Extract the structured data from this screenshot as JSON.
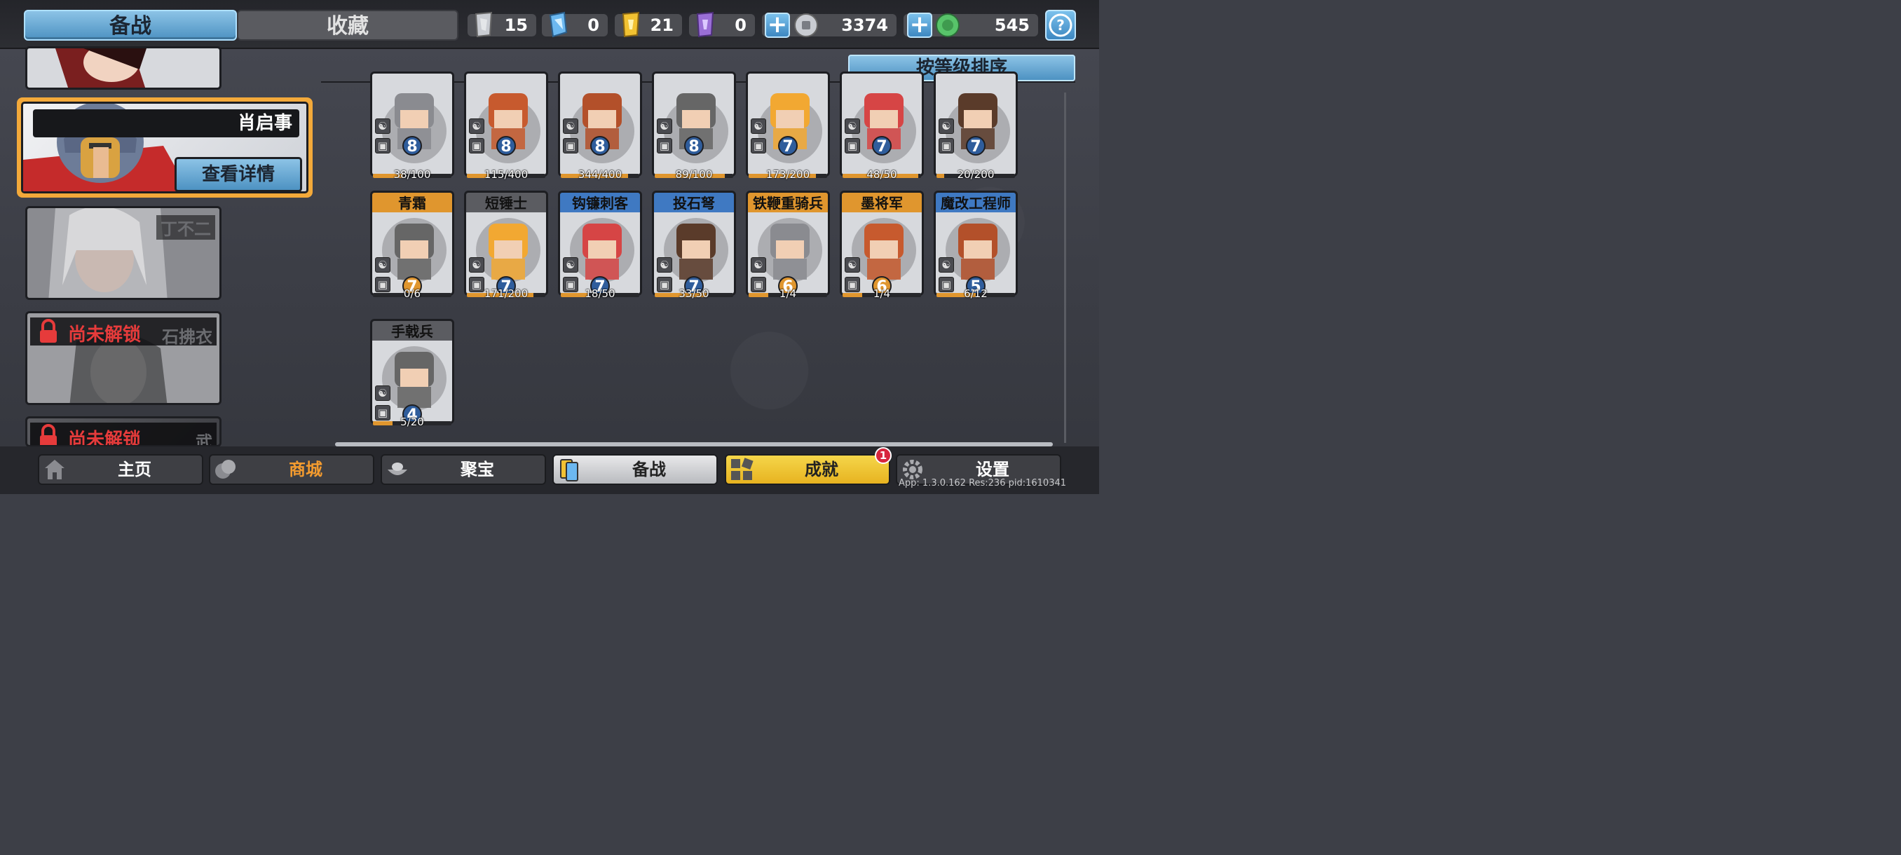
{
  "tabs": {
    "active": "备战",
    "inactive": "收藏"
  },
  "resources": [
    {
      "icon": "silver-scroll-icon",
      "value": "15",
      "color": "#c9ccd2"
    },
    {
      "icon": "blue-crystal-icon",
      "value": "0",
      "color": "#6cb8f0"
    },
    {
      "icon": "gold-scroll-icon",
      "value": "21",
      "color": "#f2c232"
    },
    {
      "icon": "purple-scroll-icon",
      "value": "0",
      "color": "#9a6fd6"
    },
    {
      "icon": "silver-coin-icon",
      "value": "3374",
      "color": "#c9ccd2"
    },
    {
      "icon": "jade-coin-icon",
      "value": "545",
      "color": "#58c46a"
    }
  ],
  "sort_label": "按等级排序",
  "heroes": [
    {
      "name": "肖启事",
      "detail_label": "查看详情"
    },
    {
      "name": "丁不二"
    },
    {
      "lock_label": "尚未解锁",
      "name": "石拂衣"
    },
    {
      "lock_label": "尚未解锁",
      "name": "武"
    }
  ],
  "units_row1": [
    {
      "level": "8",
      "count": "38/100",
      "progress": 0.38
    },
    {
      "level": "8",
      "count": "115/400",
      "progress": 0.29
    },
    {
      "level": "8",
      "count": "344/400",
      "progress": 0.86
    },
    {
      "level": "8",
      "count": "89/100",
      "progress": 0.89
    },
    {
      "level": "7",
      "count": "173/200",
      "progress": 0.86
    },
    {
      "level": "7",
      "count": "48/50",
      "progress": 0.96
    },
    {
      "level": "7",
      "count": "20/200",
      "progress": 0.1
    }
  ],
  "units_row2": [
    {
      "name": "青霜",
      "level": "7",
      "count": "0/6",
      "progress": 0.0,
      "tier": "gold"
    },
    {
      "name": "短锤士",
      "level": "7",
      "count": "171/200",
      "progress": 0.85,
      "tier": "gray"
    },
    {
      "name": "钩镰刺客",
      "level": "7",
      "count": "18/50",
      "progress": 0.36,
      "tier": "blue"
    },
    {
      "name": "投石弩",
      "level": "7",
      "count": "33/50",
      "progress": 0.66,
      "tier": "blue"
    },
    {
      "name": "铁鞭重骑兵",
      "level": "6",
      "count": "1/4",
      "progress": 0.25,
      "tier": "gold"
    },
    {
      "name": "墨将军",
      "level": "6",
      "count": "1/4",
      "progress": 0.25,
      "tier": "gold"
    },
    {
      "name": "魔改工程师",
      "level": "5",
      "count": "6/12",
      "progress": 0.5,
      "tier": "blue"
    }
  ],
  "units_row3": [
    {
      "name": "手戟兵",
      "level": "4",
      "count": "5/20",
      "progress": 0.25,
      "tier": "gray"
    }
  ],
  "nav": [
    {
      "label": "主页",
      "icon": "house-icon"
    },
    {
      "label": "商城",
      "icon": "coins-icon"
    },
    {
      "label": "聚宝",
      "icon": "treasure-bowl-icon"
    },
    {
      "label": "备战",
      "icon": "cards-icon"
    },
    {
      "label": "成就",
      "icon": "achievement-grid-icon"
    },
    {
      "label": "设置",
      "icon": "gear-icon"
    }
  ],
  "achievement_badge": "1",
  "version_text": "App: 1.3.0.162 Res:236 pid:1610341"
}
